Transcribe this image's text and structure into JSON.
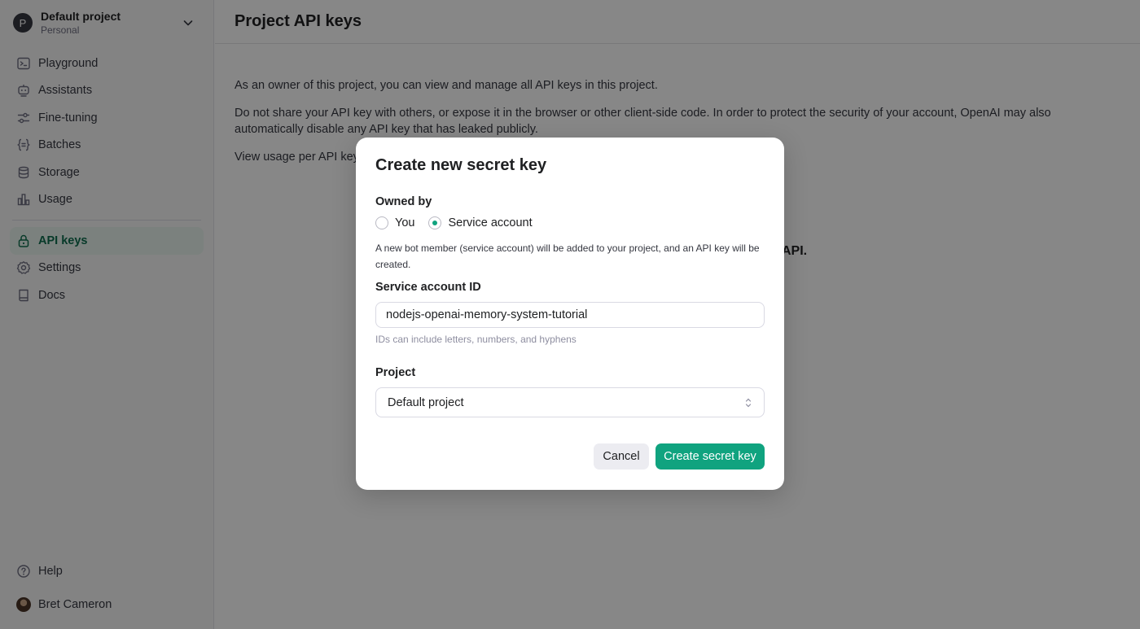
{
  "sidebar": {
    "project": {
      "avatar_letter": "P",
      "name": "Default project",
      "subtitle": "Personal"
    },
    "nav_items": [
      {
        "label": "Playground",
        "icon": "terminal-icon"
      },
      {
        "label": "Assistants",
        "icon": "robot-icon"
      },
      {
        "label": "Fine-tuning",
        "icon": "sliders-icon"
      },
      {
        "label": "Batches",
        "icon": "braces-icon"
      },
      {
        "label": "Storage",
        "icon": "database-icon"
      },
      {
        "label": "Usage",
        "icon": "bar-chart-icon"
      }
    ],
    "nav_items_secondary": [
      {
        "label": "API keys",
        "icon": "lock-icon",
        "active": true
      },
      {
        "label": "Settings",
        "icon": "gear-icon"
      },
      {
        "label": "Docs",
        "icon": "book-icon"
      }
    ],
    "help_label": "Help",
    "user_name": "Bret Cameron"
  },
  "main": {
    "title": "Project API keys",
    "paragraphs": [
      "As an owner of this project, you can view and manage all API keys in this project.",
      "Do not share your API key with others, or expose it in the browser or other client-side code. In order to protect the security of your account, OpenAI may also automatically disable any API key that has leaked publicly.",
      "View usage per API key"
    ],
    "bg_fragment": "API."
  },
  "modal": {
    "title": "Create new secret key",
    "owned_by_label": "Owned by",
    "owner_options": [
      {
        "label": "You",
        "selected": false
      },
      {
        "label": "Service account",
        "selected": true
      }
    ],
    "owner_helper": "A new bot member (service account) will be added to your project, and an API key will be created.",
    "service_id_label": "Service account ID",
    "service_id_value": "nodejs-openai-memory-system-tutorial",
    "service_id_hint": "IDs can include letters, numbers, and hyphens",
    "project_label": "Project",
    "project_value": "Default project",
    "cancel_label": "Cancel",
    "create_label": "Create secret key"
  },
  "colors": {
    "accent": "#10a37f",
    "active_bg": "#e8f3ee",
    "active_text": "#0f6e4f"
  }
}
